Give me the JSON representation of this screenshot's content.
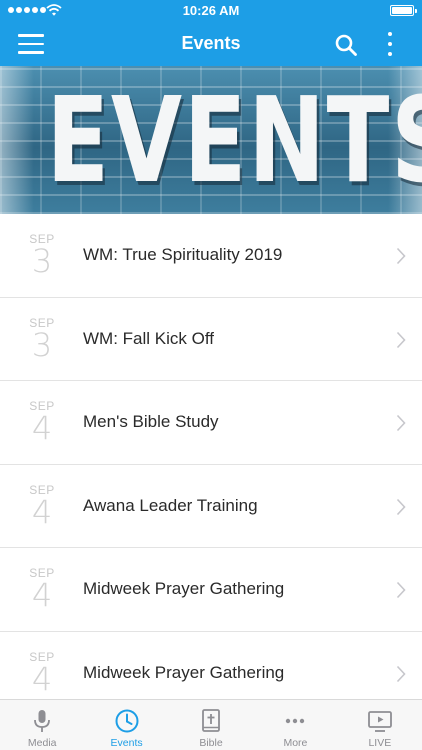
{
  "status_bar": {
    "time": "10:26 AM"
  },
  "nav": {
    "title": "Events"
  },
  "banner": {
    "text": "EVENTS"
  },
  "events": [
    {
      "month": "SEP",
      "day": "3",
      "title": "WM: True Spirituality 2019"
    },
    {
      "month": "SEP",
      "day": "3",
      "title": "WM: Fall Kick Off"
    },
    {
      "month": "SEP",
      "day": "4",
      "title": "Men's Bible Study"
    },
    {
      "month": "SEP",
      "day": "4",
      "title": "Awana Leader Training"
    },
    {
      "month": "SEP",
      "day": "4",
      "title": "Midweek Prayer Gathering"
    },
    {
      "month": "SEP",
      "day": "4",
      "title": "Midweek Prayer Gathering"
    }
  ],
  "tabs": [
    {
      "label": "Media",
      "icon": "microphone-icon"
    },
    {
      "label": "Events",
      "icon": "clock-icon",
      "active": true
    },
    {
      "label": "Bible",
      "icon": "bible-icon"
    },
    {
      "label": "More",
      "icon": "more-horizontal-icon"
    },
    {
      "label": "LIVE",
      "icon": "live-tv-icon"
    }
  ],
  "colors": {
    "accent": "#1d9ee6",
    "tab_inactive": "#8e8e93",
    "date_text": "#c8c8c8"
  }
}
